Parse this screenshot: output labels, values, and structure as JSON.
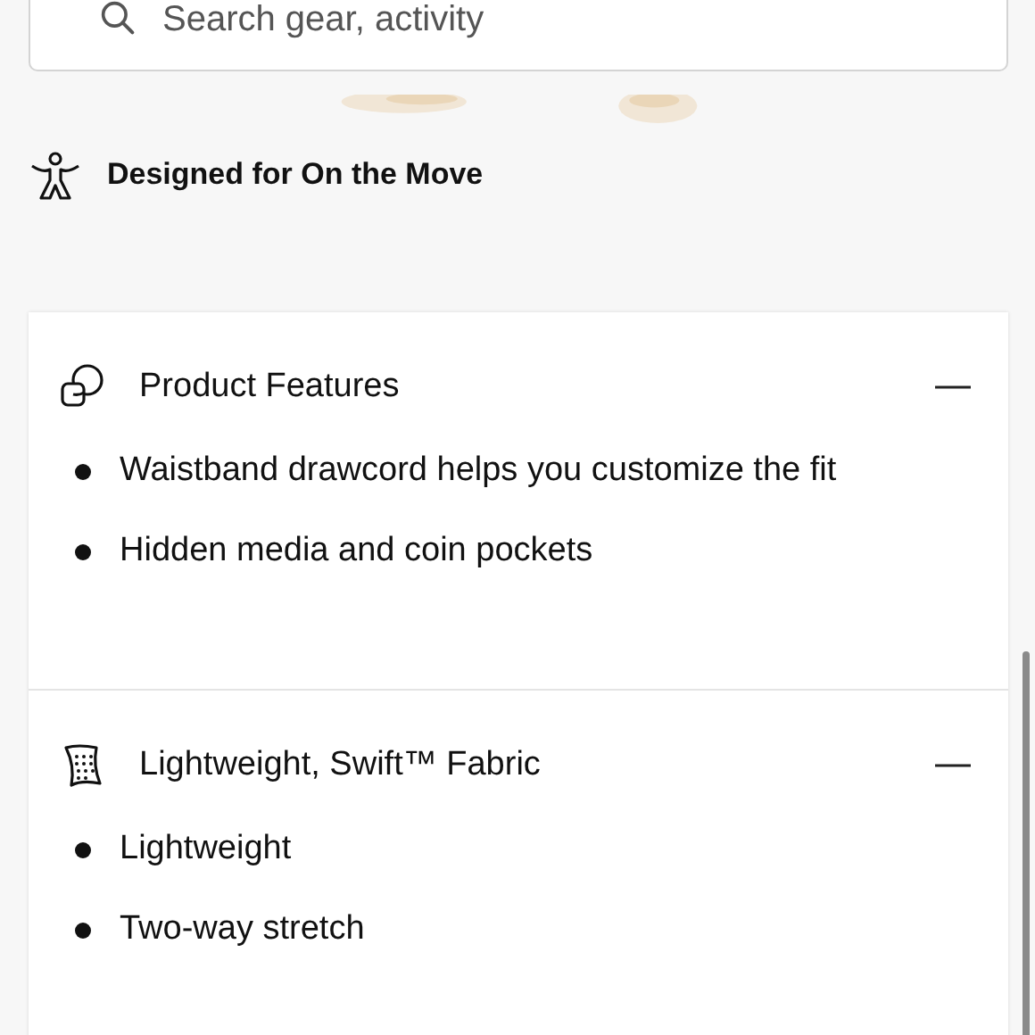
{
  "search": {
    "placeholder": "Search gear, activity"
  },
  "designed_for": {
    "label": "Designed for On the Move"
  },
  "sections": [
    {
      "title": "Product Features",
      "expanded": true,
      "items": [
        "Waistband drawcord helps you customize the fit",
        "Hidden media and coin pockets"
      ]
    },
    {
      "title": "Lightweight, Swift™ Fabric",
      "expanded": true,
      "items": [
        "Lightweight",
        "Two-way stretch"
      ]
    }
  ]
}
